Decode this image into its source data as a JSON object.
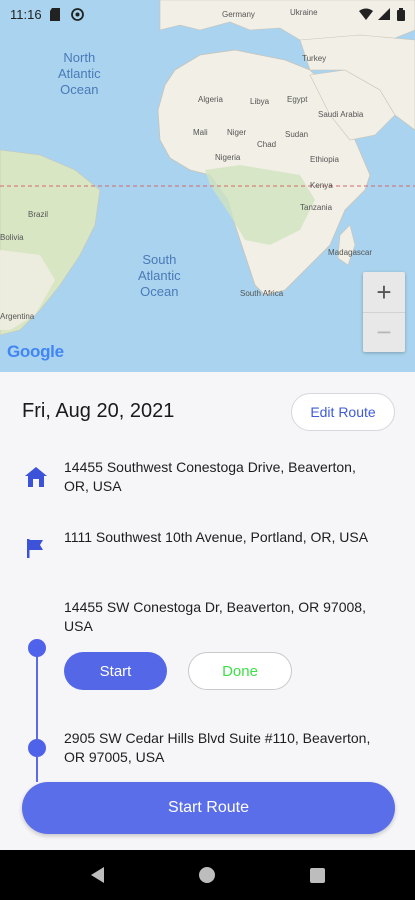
{
  "status_bar": {
    "time": "11:16",
    "icons": [
      "sd-card-icon",
      "at-sign-icon",
      "wifi-icon",
      "signal-icon",
      "battery-icon"
    ]
  },
  "map": {
    "oceans": [
      {
        "name": "North\nAtlantic\nOcean"
      },
      {
        "name": "South\nAtlantic\nOcean"
      }
    ],
    "countries": [
      "Germany",
      "Ukraine",
      "Turkey",
      "Algeria",
      "Libya",
      "Egypt",
      "Saudi Arabia",
      "Mali",
      "Niger",
      "Chad",
      "Sudan",
      "Nigeria",
      "Ethiopia",
      "Kenya",
      "Tanzania",
      "Brazil",
      "Bolivia",
      "Argentina",
      "Madagascar",
      "South Africa"
    ],
    "zoom_in_label": "+",
    "zoom_out_label": "−",
    "attribution": "Google",
    "colors": {
      "water": "#a9d3ee",
      "land": "#f2efe6",
      "equator": "#d46a6a"
    }
  },
  "route": {
    "date": "Fri, Aug 20, 2021",
    "edit_label": "Edit Route",
    "home_address": "14455 Southwest Conestoga Drive, Beaverton, OR, USA",
    "destination_address": "1111 Southwest 10th Avenue, Portland, OR, USA",
    "stops": [
      {
        "address": "14455 SW Conestoga Dr, Beaverton, OR 97008, USA"
      },
      {
        "address": "2905 SW Cedar Hills Blvd Suite #110, Beaverton, OR 97005, USA"
      }
    ],
    "start_label": "Start",
    "done_label": "Done",
    "start_route_label": "Start Route"
  },
  "colors": {
    "accent": "#5468e7",
    "done_text": "#3ee04a"
  }
}
